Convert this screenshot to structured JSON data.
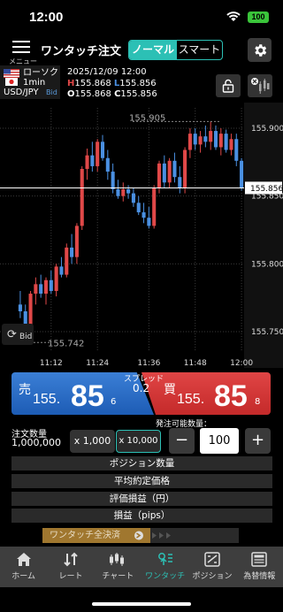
{
  "status": {
    "time": "12:00",
    "battery": "100"
  },
  "header": {
    "menu_label": "メニュー",
    "title": "ワンタッチ注文",
    "mode_normal": "ノーマル",
    "mode_smart": "スマート"
  },
  "info": {
    "chart_type": "ローソク",
    "interval": "1min",
    "symbol": "USD/JPY",
    "side": "Bid",
    "datetime": "2025/12/09 12:00",
    "H": "155.868",
    "L": "155.856",
    "O": "155.868",
    "C": "155.856"
  },
  "chart": {
    "y_ticks": [
      "155.900",
      "155.850",
      "155.800",
      "155.750"
    ],
    "x_ticks": [
      "11:12",
      "11:24",
      "11:36",
      "11:48",
      "12:00"
    ],
    "current": "155.856",
    "high_mark": "155.905",
    "low_mark": "155.742",
    "bid_btn": "Bid",
    "colors": {
      "up": "#e04848",
      "down": "#4a90e2",
      "bg": "#000000",
      "grid": "#3a3a3a"
    }
  },
  "chart_data": {
    "type": "candlestick",
    "ylim": [
      155.735,
      155.915
    ],
    "candles": [
      [
        155.77,
        155.78,
        155.76,
        155.765
      ],
      [
        155.765,
        155.77,
        155.748,
        155.752
      ],
      [
        155.752,
        155.78,
        155.748,
        155.778
      ],
      [
        155.778,
        155.79,
        155.77,
        155.785
      ],
      [
        155.785,
        155.792,
        155.775,
        155.778
      ],
      [
        155.778,
        155.79,
        155.77,
        155.788
      ],
      [
        155.788,
        155.795,
        155.778,
        155.78
      ],
      [
        155.78,
        155.8,
        155.776,
        155.798
      ],
      [
        155.798,
        155.805,
        155.79,
        155.792
      ],
      [
        155.792,
        155.815,
        155.79,
        155.812
      ],
      [
        155.812,
        155.822,
        155.8,
        155.805
      ],
      [
        155.805,
        155.83,
        155.8,
        155.828
      ],
      [
        155.828,
        155.872,
        155.825,
        155.87
      ],
      [
        155.87,
        155.885,
        155.862,
        155.88
      ],
      [
        155.88,
        155.89,
        155.868,
        155.872
      ],
      [
        155.872,
        155.892,
        155.868,
        155.89
      ],
      [
        155.89,
        155.895,
        155.876,
        155.878
      ],
      [
        155.878,
        155.884,
        155.862,
        155.868
      ],
      [
        155.868,
        155.874,
        155.852,
        155.855
      ],
      [
        155.855,
        155.862,
        155.848,
        155.85
      ],
      [
        155.85,
        155.86,
        155.846,
        155.855
      ],
      [
        155.855,
        155.858,
        155.848,
        155.852
      ],
      [
        155.852,
        155.856,
        155.842,
        155.845
      ],
      [
        155.845,
        155.85,
        155.836,
        155.838
      ],
      [
        155.838,
        155.845,
        155.83,
        155.834
      ],
      [
        155.834,
        155.842,
        155.826,
        155.828
      ],
      [
        155.828,
        155.858,
        155.826,
        155.856
      ],
      [
        155.856,
        155.876,
        155.852,
        155.874
      ],
      [
        155.874,
        155.88,
        155.856,
        155.86
      ],
      [
        155.86,
        155.878,
        155.856,
        155.876
      ],
      [
        155.876,
        155.882,
        155.86,
        155.864
      ],
      [
        155.864,
        155.872,
        155.852,
        155.856
      ],
      [
        155.856,
        155.886,
        155.852,
        155.884
      ],
      [
        155.884,
        155.9,
        155.878,
        155.896
      ],
      [
        155.896,
        155.9,
        155.884,
        155.888
      ],
      [
        155.888,
        155.898,
        155.882,
        155.894
      ],
      [
        155.894,
        155.902,
        155.886,
        155.89
      ],
      [
        155.89,
        155.905,
        155.884,
        155.898
      ],
      [
        155.898,
        155.902,
        155.884,
        155.886
      ],
      [
        155.886,
        155.9,
        155.88,
        155.896
      ],
      [
        155.896,
        155.899,
        155.882,
        155.884
      ],
      [
        155.884,
        155.896,
        155.88,
        155.892
      ],
      [
        155.892,
        155.896,
        155.872,
        155.876
      ],
      [
        155.876,
        155.878,
        155.854,
        155.856
      ]
    ]
  },
  "trade": {
    "sell_label": "売",
    "sell_small": "155.",
    "sell_big": "85",
    "sell_sup": "6",
    "buy_label": "買",
    "buy_small": "155.",
    "buy_big": "85",
    "buy_sup": "8",
    "spread_label": "スプレッド",
    "spread_value": "0.2",
    "order_qty_label": "注文数量",
    "order_qty_value": "1,000,000",
    "qty_display": "x 1,000",
    "multiplier_btn": "x 10,000",
    "orderable_label": "発注可能数量：",
    "minus": "−",
    "plus": "+",
    "qty_input": "100",
    "rows": [
      "ポジション数量",
      "平均約定価格",
      "評価損益（円）",
      "損益（pips）"
    ],
    "close_all": "ワンタッチ全決済"
  },
  "nav": {
    "items": [
      "ホーム",
      "レート",
      "チャート",
      "ワンタッチ",
      "ポジション",
      "為替情報"
    ],
    "active": 3
  }
}
